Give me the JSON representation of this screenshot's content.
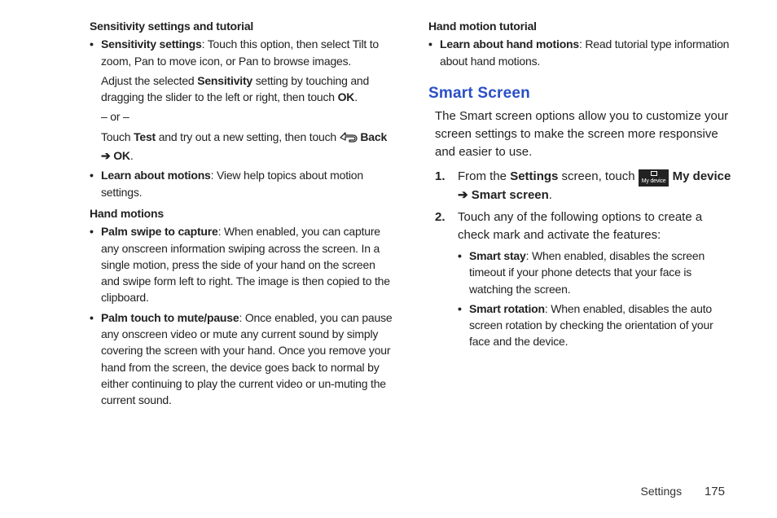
{
  "col1": {
    "sensitivity_heading": "Sensitivity settings and tutorial",
    "sens_b1_bold": "Sensitivity settings",
    "sens_b1_rest": ": Touch this option, then select Tilt to zoom, Pan to move icon, or Pan to browse images.",
    "sens_p2a": "Adjust the selected ",
    "sens_p2b_bold": "Sensitivity",
    "sens_p2c": " setting by touching and dragging the slider to the left or right, then touch ",
    "sens_p2d_bold": "OK",
    "sens_p2e": ".",
    "sens_or": "– or –",
    "sens_p3a": "Touch ",
    "sens_p3b_bold": "Test",
    "sens_p3c": " and try out a new setting, then touch ",
    "sens_p3d_bold": " Back ➔ OK",
    "sens_p3e": ".",
    "sens_b2_bold": "Learn about motions",
    "sens_b2_rest": ": View help topics about motion settings.",
    "hand_heading": "Hand motions",
    "hand_b1_bold": "Palm swipe to capture",
    "hand_b1_rest": ": When enabled, you can capture any onscreen information swiping across the screen. In a single motion, press the side of your hand on the screen and swipe form left to right. The image is then copied to the clipboard.",
    "hand_b2_bold": "Palm touch to mute/pause",
    "hand_b2_rest": ": Once enabled, you can pause any onscreen video or mute any current sound by simply covering the screen with your hand. Once you remove your hand from the screen, the device goes back to normal by either continuing to play the current video or un-muting the current sound."
  },
  "col2": {
    "handtut_heading": "Hand motion tutorial",
    "handtut_b1_bold": "Learn about hand motions",
    "handtut_b1_rest": ": Read tutorial type information about hand motions.",
    "smart_title": "Smart Screen",
    "smart_intro": "The Smart screen options allow you to customize your screen settings to make the screen more responsive and easier to use.",
    "step1_a": "From the ",
    "step1_b_bold": "Settings",
    "step1_c": " screen, touch ",
    "step1_icon_label": "My device",
    "step1_d_bold": " My device ➔ Smart screen",
    "step1_e": ".",
    "step2": "Touch any of the following options to create a check mark and activate the features:",
    "sub_b1_bold": "Smart stay",
    "sub_b1_rest": ": When enabled, disables the screen timeout if your phone detects that your face is watching the screen.",
    "sub_b2_bold": "Smart rotation",
    "sub_b2_rest": ": When enabled, disables the auto screen rotation by checking the orientation of your face and the device."
  },
  "footer": {
    "section": "Settings",
    "page": "175"
  },
  "markers": {
    "bullet": "•",
    "n1": "1.",
    "n2": "2."
  }
}
